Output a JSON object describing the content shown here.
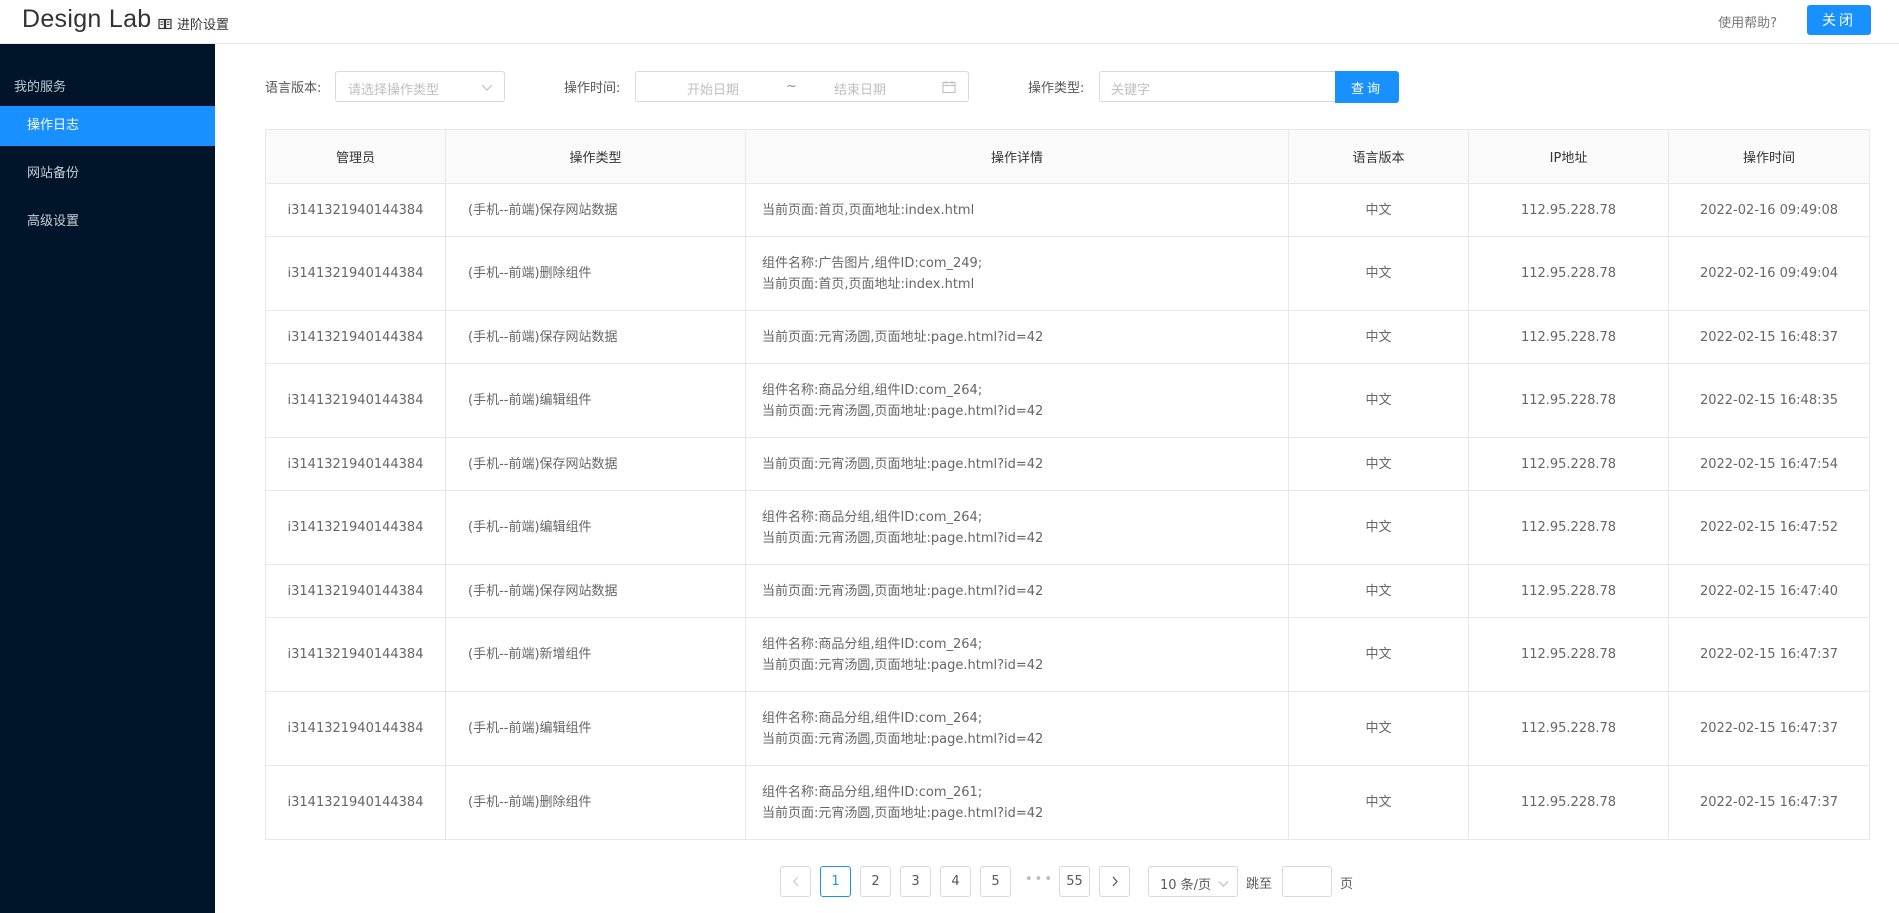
{
  "header": {
    "brand": "Design Lab",
    "advanced_settings": "进阶设置",
    "help": "使用帮助?",
    "close": "关闭"
  },
  "sidebar": {
    "group": "我的服务",
    "items": [
      {
        "label": "操作日志",
        "active": true
      },
      {
        "label": "网站备份",
        "active": false
      },
      {
        "label": "高级设置",
        "active": false
      }
    ]
  },
  "filters": {
    "language_label": "语言版本:",
    "language_placeholder": "请选择操作类型",
    "time_label": "操作时间:",
    "start_placeholder": "开始日期",
    "range_sep": "~",
    "end_placeholder": "结束日期",
    "type_label": "操作类型:",
    "keyword_placeholder": "关键字",
    "query": "查询"
  },
  "table": {
    "headers": [
      "管理员",
      "操作类型",
      "操作详情",
      "语言版本",
      "IP地址",
      "操作时间"
    ],
    "rows": [
      {
        "admin": "i3141321940144384",
        "op": "(手机--前端)保存网站数据",
        "d1": "当前页面:首页,页面地址:index.html",
        "d2": "",
        "lang": "中文",
        "ip": "112.95.228.78",
        "time": "2022-02-16 09:49:08"
      },
      {
        "admin": "i3141321940144384",
        "op": "(手机--前端)删除组件",
        "d1": "组件名称:广告图片,组件ID:com_249;",
        "d2": "当前页面:首页,页面地址:index.html",
        "lang": "中文",
        "ip": "112.95.228.78",
        "time": "2022-02-16 09:49:04"
      },
      {
        "admin": "i3141321940144384",
        "op": "(手机--前端)保存网站数据",
        "d1": "当前页面:元宵汤圆,页面地址:page.html?id=42",
        "d2": "",
        "lang": "中文",
        "ip": "112.95.228.78",
        "time": "2022-02-15 16:48:37"
      },
      {
        "admin": "i3141321940144384",
        "op": "(手机--前端)编辑组件",
        "d1": "组件名称:商品分组,组件ID:com_264;",
        "d2": "当前页面:元宵汤圆,页面地址:page.html?id=42",
        "lang": "中文",
        "ip": "112.95.228.78",
        "time": "2022-02-15 16:48:35"
      },
      {
        "admin": "i3141321940144384",
        "op": "(手机--前端)保存网站数据",
        "d1": "当前页面:元宵汤圆,页面地址:page.html?id=42",
        "d2": "",
        "lang": "中文",
        "ip": "112.95.228.78",
        "time": "2022-02-15 16:47:54"
      },
      {
        "admin": "i3141321940144384",
        "op": "(手机--前端)编辑组件",
        "d1": "组件名称:商品分组,组件ID:com_264;",
        "d2": "当前页面:元宵汤圆,页面地址:page.html?id=42",
        "lang": "中文",
        "ip": "112.95.228.78",
        "time": "2022-02-15 16:47:52"
      },
      {
        "admin": "i3141321940144384",
        "op": "(手机--前端)保存网站数据",
        "d1": "当前页面:元宵汤圆,页面地址:page.html?id=42",
        "d2": "",
        "lang": "中文",
        "ip": "112.95.228.78",
        "time": "2022-02-15 16:47:40"
      },
      {
        "admin": "i3141321940144384",
        "op": "(手机--前端)新增组件",
        "d1": "组件名称:商品分组,组件ID:com_264;",
        "d2": "当前页面:元宵汤圆,页面地址:page.html?id=42",
        "lang": "中文",
        "ip": "112.95.228.78",
        "time": "2022-02-15 16:47:37"
      },
      {
        "admin": "i3141321940144384",
        "op": "(手机--前端)编辑组件",
        "d1": "组件名称:商品分组,组件ID:com_264;",
        "d2": "当前页面:元宵汤圆,页面地址:page.html?id=42",
        "lang": "中文",
        "ip": "112.95.228.78",
        "time": "2022-02-15 16:47:37"
      },
      {
        "admin": "i3141321940144384",
        "op": "(手机--前端)删除组件",
        "d1": "组件名称:商品分组,组件ID:com_261;",
        "d2": "当前页面:元宵汤圆,页面地址:page.html?id=42",
        "lang": "中文",
        "ip": "112.95.228.78",
        "time": "2022-02-15 16:47:37"
      }
    ]
  },
  "pagination": {
    "pages": [
      "1",
      "2",
      "3",
      "4",
      "5"
    ],
    "current": "1",
    "ellipsis": "•••",
    "last": "55",
    "page_size": "10 条/页",
    "jump_label": "跳至",
    "page_suffix": "页"
  },
  "colors": {
    "accent": "#1890ff",
    "sidebar_bg": "#001529"
  }
}
